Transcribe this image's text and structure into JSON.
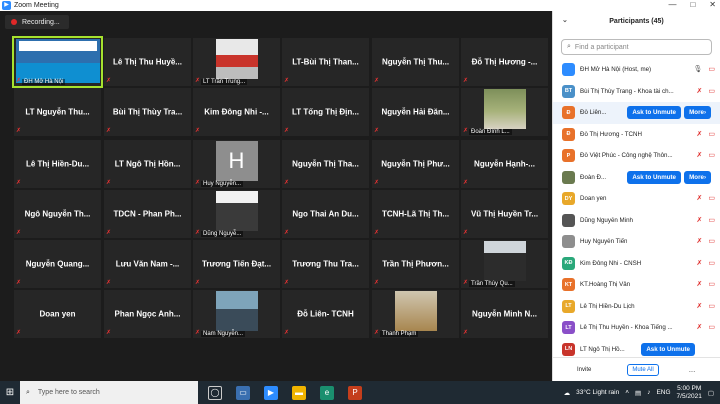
{
  "window": {
    "title": "Zoom Meeting",
    "controls": [
      "—",
      "□",
      "✕"
    ]
  },
  "recording": {
    "label": "Recording..."
  },
  "tiles": [
    {
      "name": "",
      "caption": "ĐH Mở Hà Nội",
      "video": "v8",
      "active": true
    },
    {
      "name": "Lê Thị Thu Huyề...",
      "caption": "",
      "video": ""
    },
    {
      "name": "",
      "caption": "LT Trần Trung...",
      "video": "v1"
    },
    {
      "name": "LT-Bùi Thị Than...",
      "caption": "",
      "video": ""
    },
    {
      "name": "Nguyễn Thị Thu...",
      "caption": "",
      "video": ""
    },
    {
      "name": "Đỗ Thị Hương -...",
      "caption": "",
      "video": ""
    },
    {
      "name": "LT Nguyễn Thu...",
      "caption": "",
      "video": ""
    },
    {
      "name": "Bùi Thị Thùy Tra...",
      "caption": "",
      "video": ""
    },
    {
      "name": "Kim Đông Nhi -...",
      "caption": "",
      "video": ""
    },
    {
      "name": "LT Tống Thị Địn...",
      "caption": "",
      "video": ""
    },
    {
      "name": "Nguyễn Hải Đăn...",
      "caption": "",
      "video": ""
    },
    {
      "name": "",
      "caption": "Đoàn Đình L...",
      "video": "v2"
    },
    {
      "name": "Lê Thị Hiền-Du...",
      "caption": "",
      "video": ""
    },
    {
      "name": "LT Ngô Thị Hồn...",
      "caption": "",
      "video": ""
    },
    {
      "name": "",
      "caption": "Huy Nguyễn...",
      "video": "v3",
      "letter": "H"
    },
    {
      "name": "Nguyễn Thị Tha...",
      "caption": "",
      "video": ""
    },
    {
      "name": "Nguyễn Thị Phư...",
      "caption": "",
      "video": ""
    },
    {
      "name": "Nguyễn Hạnh-...",
      "caption": "",
      "video": ""
    },
    {
      "name": "Ngô Nguyễn Th...",
      "caption": "",
      "video": ""
    },
    {
      "name": "TDCN - Phan Ph...",
      "caption": "",
      "video": ""
    },
    {
      "name": "",
      "caption": "Dũng Nguyễ...",
      "video": "v4"
    },
    {
      "name": "Ngo Thai An Du...",
      "caption": "",
      "video": ""
    },
    {
      "name": "TCNH-Lã Thị Th...",
      "caption": "",
      "video": ""
    },
    {
      "name": "Vũ Thị Huyền Tr...",
      "caption": "",
      "video": ""
    },
    {
      "name": "Nguyễn Quang...",
      "caption": "",
      "video": ""
    },
    {
      "name": "Lưu Văn Nam -...",
      "caption": "",
      "video": ""
    },
    {
      "name": "Trương Tiến Đạt...",
      "caption": "",
      "video": ""
    },
    {
      "name": "Trương Thu Tra...",
      "caption": "",
      "video": ""
    },
    {
      "name": "Trần Thị Phươn...",
      "caption": "",
      "video": ""
    },
    {
      "name": "",
      "caption": "Trần Thúy Qu...",
      "video": "v5"
    },
    {
      "name": "Doan yen",
      "caption": "",
      "video": ""
    },
    {
      "name": "Phan Ngọc Anh...",
      "caption": "",
      "video": ""
    },
    {
      "name": "",
      "caption": "Nam Nguyễn...",
      "video": "v6"
    },
    {
      "name": "Đỗ Liên- TCNH",
      "caption": "",
      "video": ""
    },
    {
      "name": "",
      "caption": "Thanh Phạm",
      "video": "v7"
    },
    {
      "name": "Nguyễn Minh N...",
      "caption": "",
      "video": ""
    }
  ],
  "participants": {
    "title": "Participants (45)",
    "search_placeholder": "Find a participant",
    "unmute_label": "Ask to Unmute",
    "more_label": "More",
    "items": [
      {
        "initials": "",
        "name": "ĐH Mở Hà Nội (Host, me)",
        "color": "#2d8cff",
        "highlight": false,
        "unmute": false
      },
      {
        "initials": "BT",
        "name": "Bùi Thị Thùy Trang - Khoa tài ch...",
        "color": "#4a90c8",
        "highlight": false,
        "unmute": false
      },
      {
        "initials": "Đ",
        "name": "Đỗ Liên...",
        "color": "#e8712a",
        "highlight": true,
        "unmute": true,
        "more": true
      },
      {
        "initials": "Đ",
        "name": "Đỗ Thị Hương - TCNH",
        "color": "#e8712a",
        "highlight": false,
        "unmute": false
      },
      {
        "initials": "P",
        "name": "Đỗ Việt Phúc - Công nghệ Thôn...",
        "color": "#e8712a",
        "highlight": false,
        "unmute": false
      },
      {
        "initials": "",
        "name": "Đoàn Đ...",
        "color": "#6a7a4f",
        "highlight": false,
        "unmute": true,
        "more": true
      },
      {
        "initials": "DY",
        "name": "Doan yen",
        "color": "#e8a82a",
        "highlight": false,
        "unmute": false
      },
      {
        "initials": "",
        "name": "Dũng Nguyễn Minh",
        "color": "#555555",
        "highlight": false,
        "unmute": false
      },
      {
        "initials": "",
        "name": "Huy Nguyễn Tiến",
        "color": "#8e8e8e",
        "highlight": false,
        "unmute": false
      },
      {
        "initials": "KĐ",
        "name": "Kim Đông Nhi - CNSH",
        "color": "#2aa87a",
        "highlight": false,
        "unmute": false
      },
      {
        "initials": "KT",
        "name": "KT.Hoàng Thị Vân",
        "color": "#e8712a",
        "highlight": false,
        "unmute": false
      },
      {
        "initials": "LT",
        "name": "Lê Thị Hiền-Du Lịch",
        "color": "#e8a82a",
        "highlight": false,
        "unmute": false
      },
      {
        "initials": "LT",
        "name": "Lê Thị Thu Huyền - Khoa Tiếng ...",
        "color": "#8a4fc8",
        "highlight": false,
        "unmute": false
      },
      {
        "initials": "LN",
        "name": "LT Ngô Thị Hồ...",
        "color": "#c8342b",
        "highlight": false,
        "unmute": true,
        "more": false
      }
    ],
    "invite_label": "Invite",
    "mute_all_label": "Mute All",
    "more_dots": "..."
  },
  "taskbar": {
    "search_placeholder": "Type here to search",
    "weather": "33°C  Light rain",
    "lang": "ENG",
    "time": "5:00 PM",
    "date": "7/5/2021"
  }
}
